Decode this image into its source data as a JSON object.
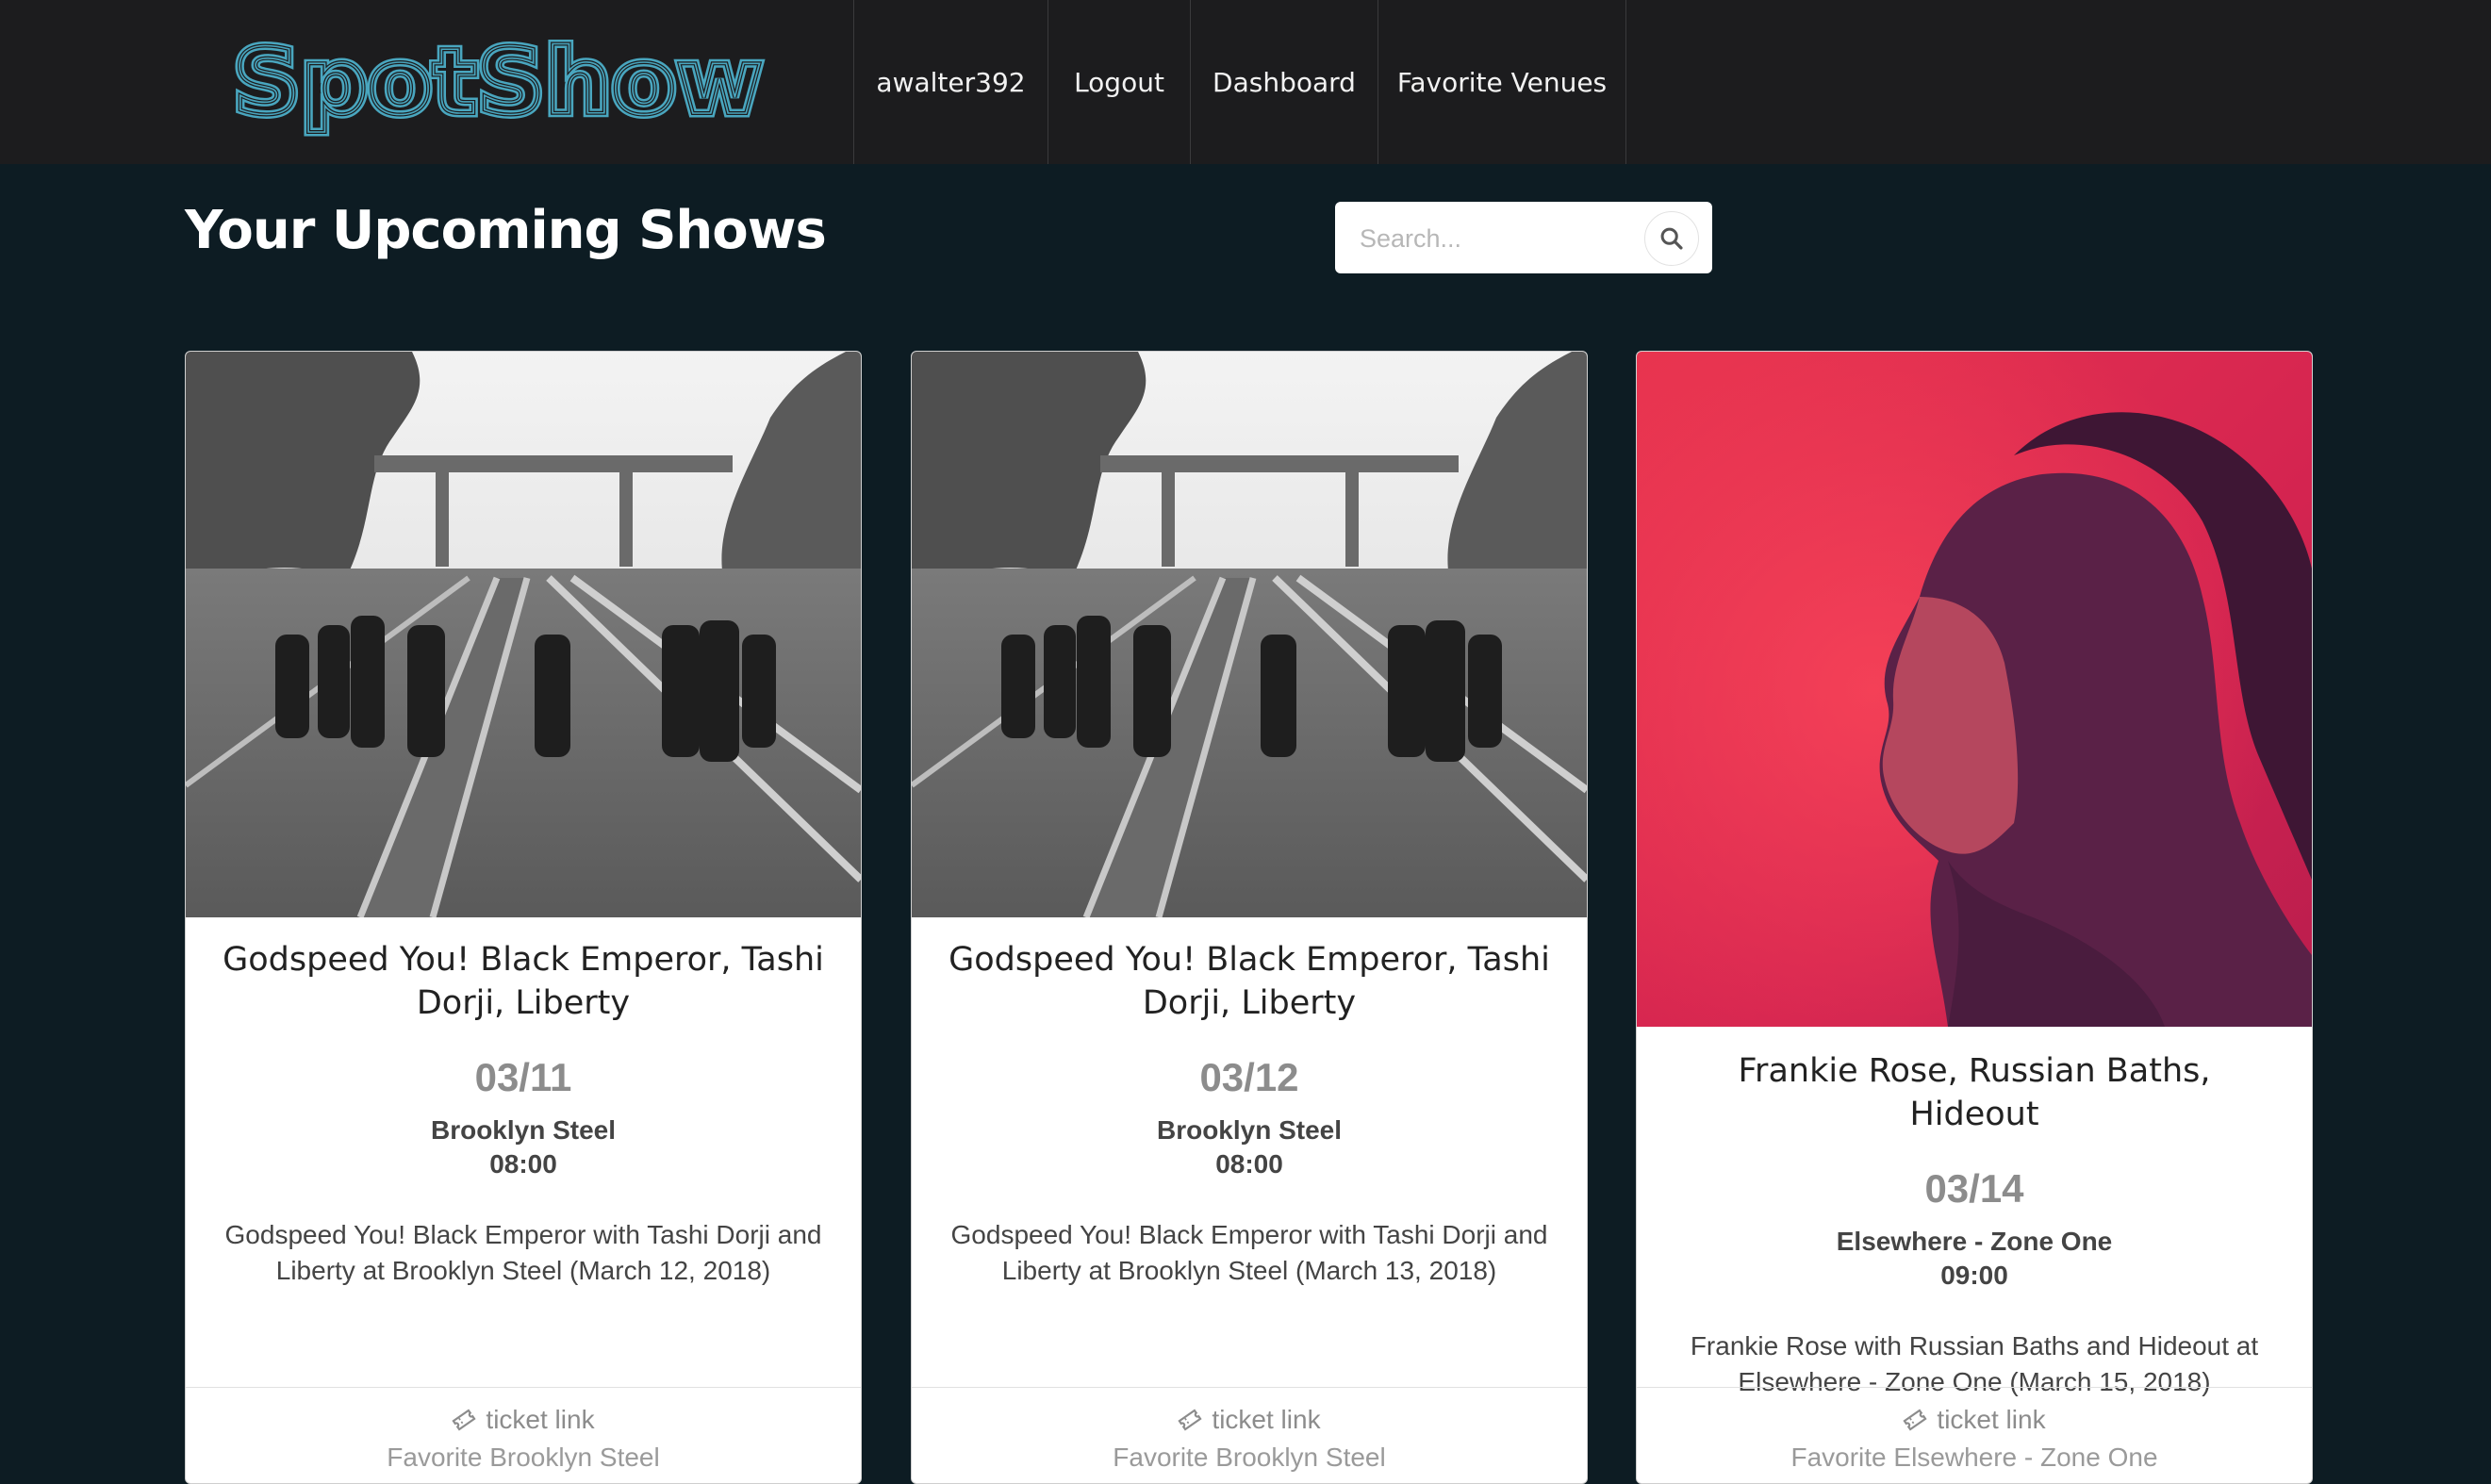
{
  "app": {
    "logo_text": "SpotShow",
    "accent_color": "#49a6bf"
  },
  "nav": {
    "items": [
      {
        "label": "awalter392"
      },
      {
        "label": "Logout"
      },
      {
        "label": "Dashboard"
      },
      {
        "label": "Favorite Venues"
      }
    ]
  },
  "main": {
    "title": "Your Upcoming Shows",
    "search": {
      "placeholder": "Search...",
      "value": "",
      "icon": "search-icon"
    }
  },
  "shows": [
    {
      "title": "Godspeed You! Black Emperor, Tashi Dorji, Liberty",
      "date": "03/11",
      "venue": "Brooklyn Steel",
      "time": "08:00",
      "description": "Godspeed You! Black Emperor with Tashi Dorji and Liberty at Brooklyn Steel (March 12, 2018)",
      "ticket_label": "ticket link",
      "favorite_label": "Favorite Brooklyn Steel",
      "image": "black-and-white band photo on railroad tracks"
    },
    {
      "title": "Godspeed You! Black Emperor, Tashi Dorji, Liberty",
      "date": "03/12",
      "venue": "Brooklyn Steel",
      "time": "08:00",
      "description": "Godspeed You! Black Emperor with Tashi Dorji and Liberty at Brooklyn Steel (March 13, 2018)",
      "ticket_label": "ticket link",
      "favorite_label": "Favorite Brooklyn Steel",
      "image": "black-and-white band photo on railroad tracks"
    },
    {
      "title": "Frankie Rose, Russian Baths, Hideout",
      "date": "03/14",
      "venue": "Elsewhere - Zone One",
      "time": "09:00",
      "description": "Frankie Rose with Russian Baths and Hideout at Elsewhere - Zone One (March 15, 2018)",
      "ticket_label": "ticket link",
      "favorite_label": "Favorite Elsewhere - Zone One",
      "image": "portrait of woman in red light"
    }
  ]
}
